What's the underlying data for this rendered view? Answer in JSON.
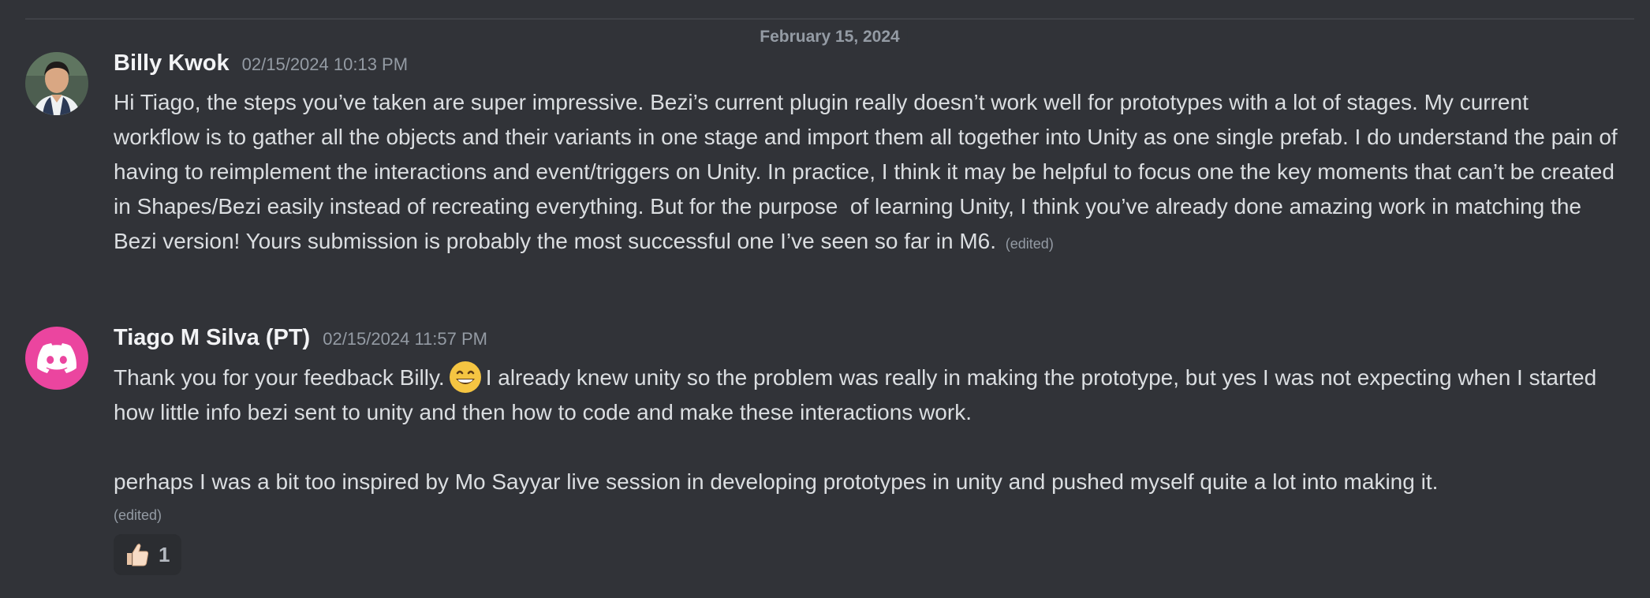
{
  "date_divider": "February 15, 2024",
  "messages": [
    {
      "author": "Billy Kwok",
      "timestamp": "02/15/2024 10:13 PM",
      "text": "Hi Tiago, the steps you’ve taken are super impressive. Bezi’s current plugin really doesn’t work well for prototypes with a lot of stages. My current workflow is to gather all the objects and their variants in one stage and import them all together into Unity as one single prefab. I do understand the pain of having to reimplement the interactions and event/triggers on Unity. In practice, I think it may be helpful to focus one the key moments that can’t be created in Shapes/Bezi easily instead of recreating everything. But for the purpose  of learning Unity, I think you’ve already done amazing work in matching the Bezi version! Yours submission is probably the most successful one I’ve seen so far in M6.",
      "edited_label": "(edited)",
      "avatar_icon": "user-photo-avatar"
    },
    {
      "author": "Tiago M Silva (PT)",
      "timestamp": "02/15/2024 11:57 PM",
      "text_before_emoji": "Thank you for your feedback Billy.",
      "emoji": "grinning-face-icon",
      "text_after_emoji": "I already knew unity so the problem was really in making the prototype, but yes I was not expecting when I started how little info bezi sent to unity and then how to code and make these interactions work.",
      "text_paragraph_2": "perhaps I was a bit too inspired by Mo Sayyar live session in developing prototypes in unity and pushed myself quite a lot into making it.",
      "edited_label": "(edited)",
      "avatar_icon": "discord-logo-icon",
      "reaction": {
        "emoji": "thumbs-up-icon",
        "count": "1"
      }
    }
  ],
  "colors": {
    "background": "#313338",
    "text": "#dbdee1",
    "username": "#f2f3f5",
    "muted": "#949ba4",
    "discord_avatar": "#eb459f"
  }
}
